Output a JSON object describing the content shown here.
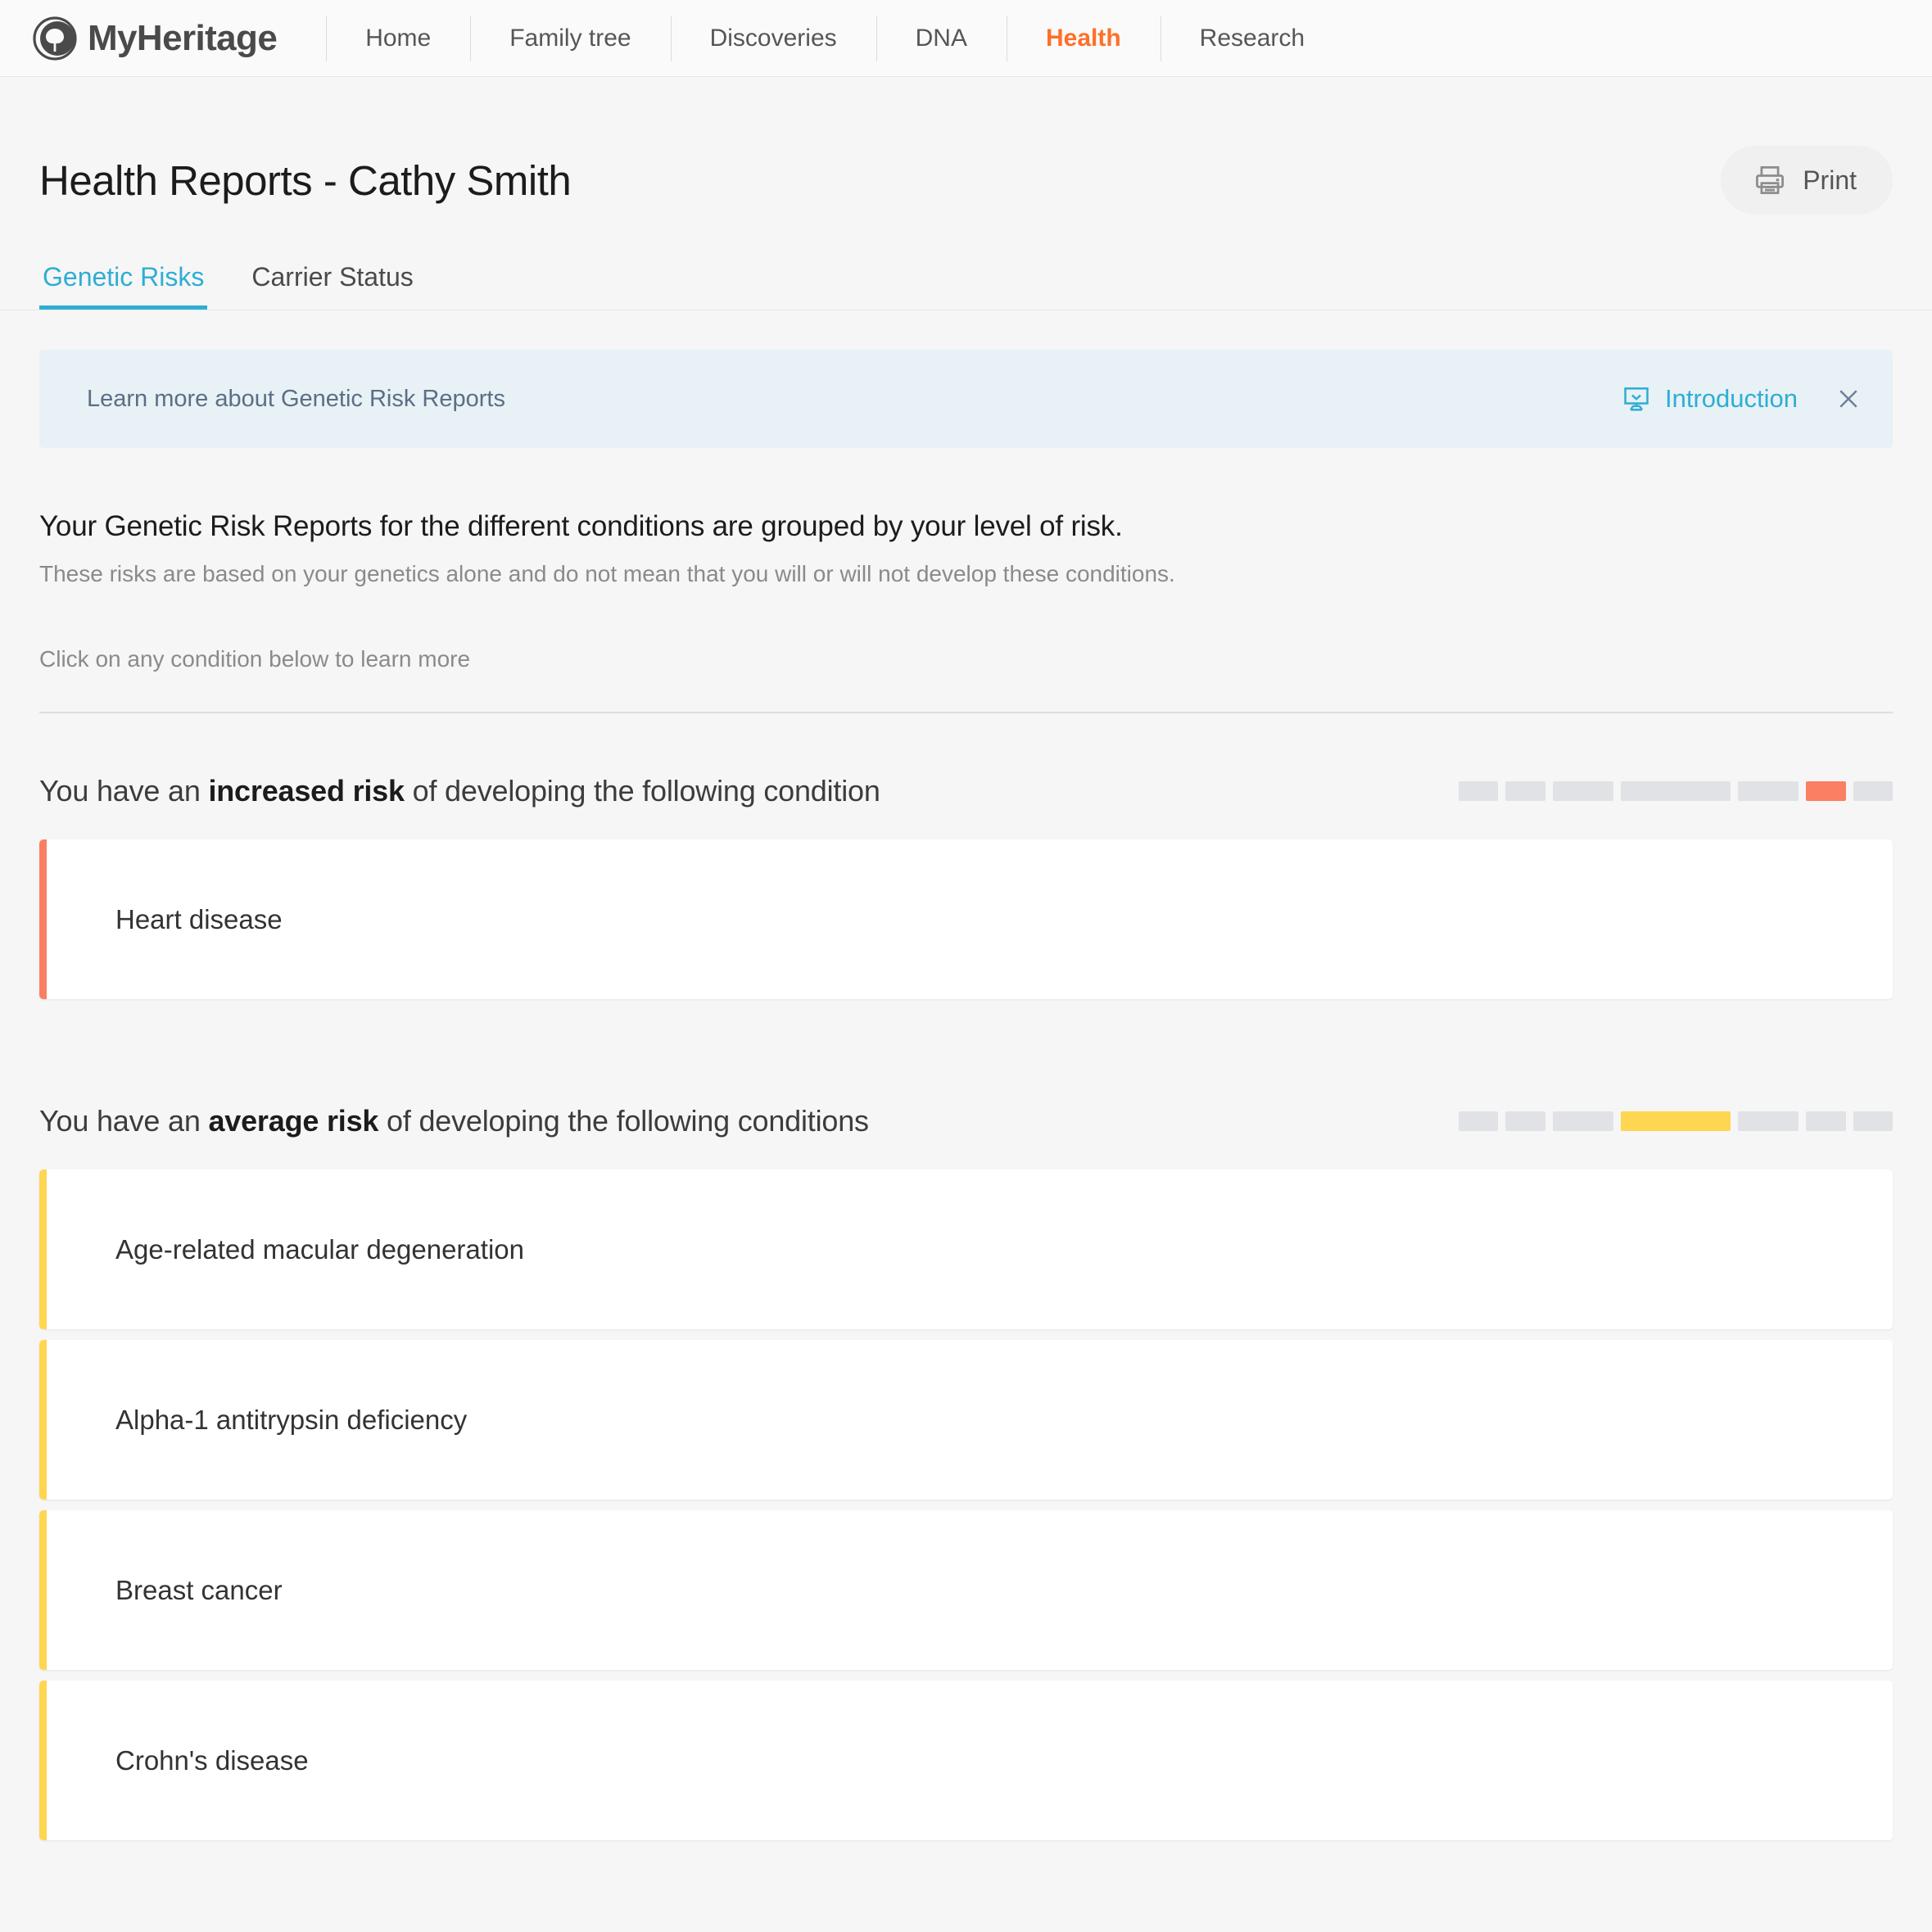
{
  "nav": {
    "brand_name": "MyHeritage",
    "brand_icon": "myheritage-tree-logo",
    "items": [
      {
        "label": "Home",
        "active": false
      },
      {
        "label": "Family tree",
        "active": false
      },
      {
        "label": "Discoveries",
        "active": false
      },
      {
        "label": "DNA",
        "active": false
      },
      {
        "label": "Health",
        "active": true
      },
      {
        "label": "Research",
        "active": false
      }
    ],
    "active_color": "#ff6f29"
  },
  "header": {
    "title": "Health Reports - Cathy Smith",
    "print_label": "Print",
    "print_icon": "printer-icon"
  },
  "tabs": [
    {
      "label": "Genetic Risks",
      "active": true
    },
    {
      "label": "Carrier Status",
      "active": false
    }
  ],
  "tab_accent_color": "#2eaed4",
  "banner": {
    "text": "Learn more about Genetic Risk Reports",
    "intro_label": "Introduction",
    "intro_icon": "presentation-screen-icon",
    "close_icon": "close-icon",
    "background_color": "#e8f1f5",
    "text_color": "#5a6f86"
  },
  "intro": {
    "headline": "Your Genetic Risk Reports for the different conditions are grouped by your level of risk.",
    "subline": "These risks are based on your genetics alone and do not mean that you will or will not develop these conditions.",
    "hint": "Click on any condition below to learn more"
  },
  "sections": [
    {
      "title_prefix": "You have an ",
      "title_emphasis": "increased risk",
      "title_suffix": " of developing the following condition",
      "accent_color": "#fb7f63",
      "meter": {
        "segment_widths": [
          48,
          49,
          74,
          134,
          74,
          49,
          48
        ],
        "active_index": 5,
        "active_color": "#fb7f63",
        "inactive_color": "#e1e2e6"
      },
      "conditions": [
        "Heart disease"
      ]
    },
    {
      "title_prefix": "You have an ",
      "title_emphasis": "average risk",
      "title_suffix": " of developing the following conditions",
      "accent_color": "#ffd651",
      "meter": {
        "segment_widths": [
          48,
          49,
          74,
          134,
          74,
          49,
          48
        ],
        "active_index": 3,
        "active_color": "#ffd651",
        "inactive_color": "#e1e2e6"
      },
      "conditions": [
        "Age-related macular degeneration",
        "Alpha-1 antitrypsin deficiency",
        "Breast cancer",
        "Crohn's disease"
      ]
    }
  ]
}
